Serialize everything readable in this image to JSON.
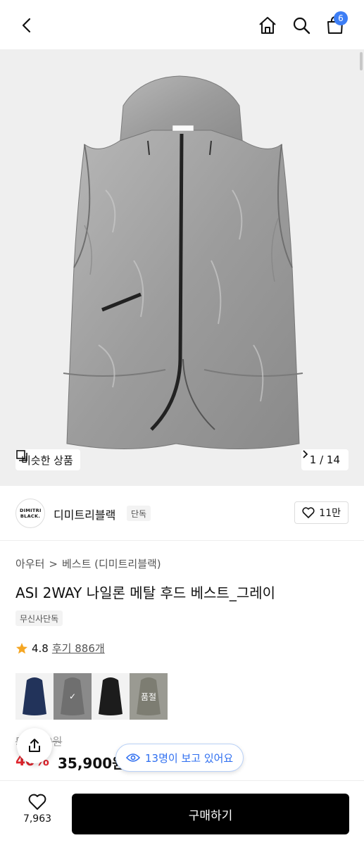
{
  "header": {
    "back_icon": "chevron-left-icon",
    "home_icon": "home-icon",
    "search_icon": "search-icon",
    "bag_icon": "shopping-bag-icon",
    "cart_count": "6"
  },
  "gallery": {
    "similar_label": "비슷한 상품",
    "counter": "1 / 14"
  },
  "brand": {
    "logo_text": "DIMITRI BLACK.",
    "name": "디미트리블랙",
    "tag": "단독",
    "likes": "11만"
  },
  "product": {
    "breadcrumb_1": "아우터",
    "breadcrumb_sep": ">",
    "breadcrumb_2": "베스트 (디미트리블랙)",
    "title": "ASI 2WAY 나일론 메탈 후드 베스트_그레이",
    "exclusive_tag": "무신사단독",
    "rating": "4.8",
    "reviews": "후기 886개"
  },
  "variants": [
    {
      "color": "navy",
      "overlay": ""
    },
    {
      "color": "gray",
      "overlay": "✓"
    },
    {
      "color": "black",
      "overlay": ""
    },
    {
      "color": "khaki",
      "overlay": "품절"
    }
  ],
  "price": {
    "original": "59,900원",
    "discount": "40%",
    "sale": "35,900원"
  },
  "viewers": {
    "text": "13명이 보고 있어요"
  },
  "bottom": {
    "wish_count": "7,963",
    "buy_label": "구매하기"
  },
  "colors": {
    "accent_blue": "#3d7ef5",
    "discount_red": "#e0242d",
    "buy_button": "#000000"
  }
}
